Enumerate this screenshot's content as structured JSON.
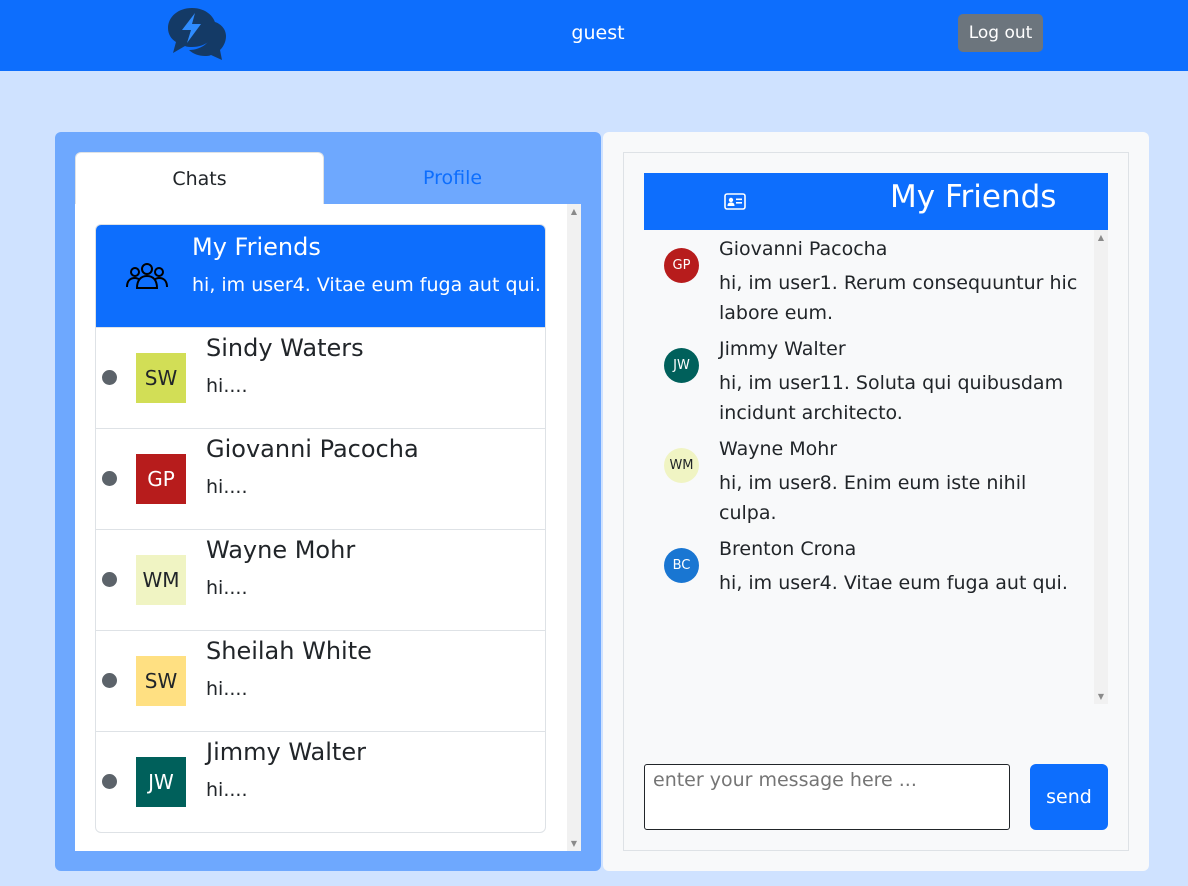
{
  "nav": {
    "username": "guest",
    "logout_label": "Log out",
    "logo_icon": "chat-bubbles-bolt-icon"
  },
  "tabs": [
    {
      "label": "Chats",
      "active": true
    },
    {
      "label": "Profile",
      "active": false
    }
  ],
  "chat_list": {
    "group": {
      "title": "My Friends",
      "last_message": "hi, im user4. Vitae eum fuga aut qui.",
      "icon": "people-icon"
    },
    "friends": [
      {
        "initials": "SW",
        "name": "Sindy Waters",
        "last_message": "hi....",
        "color": "#d2de56",
        "text_color": "#212529"
      },
      {
        "initials": "GP",
        "name": "Giovanni Pacocha",
        "last_message": "hi....",
        "color": "#b71c1c",
        "text_color": "#ffffff"
      },
      {
        "initials": "WM",
        "name": "Wayne Mohr",
        "last_message": "hi....",
        "color": "#f0f4c3",
        "text_color": "#212529"
      },
      {
        "initials": "SW",
        "name": "Sheilah White",
        "last_message": "hi....",
        "color": "#ffe082",
        "text_color": "#212529"
      },
      {
        "initials": "JW",
        "name": "Jimmy Walter",
        "last_message": "hi....",
        "color": "#00605b",
        "text_color": "#ffffff"
      }
    ]
  },
  "chat": {
    "title": "My Friends",
    "header_icon": "contact-card-icon",
    "messages": [
      {
        "initials": "GP",
        "name": "Giovanni Pacocha",
        "text": "hi, im user1. Rerum consequuntur hic labore eum.",
        "color": "#b71c1c",
        "text_color": "#ffffff"
      },
      {
        "initials": "JW",
        "name": "Jimmy Walter",
        "text": "hi, im user11. Soluta qui quibusdam incidunt architecto.",
        "color": "#00605b",
        "text_color": "#ffffff"
      },
      {
        "initials": "WM",
        "name": "Wayne Mohr",
        "text": "hi, im user8. Enim eum iste nihil culpa.",
        "color": "#f0f4c3",
        "text_color": "#212529"
      },
      {
        "initials": "BC",
        "name": "Brenton Crona",
        "text": "hi, im user4. Vitae eum fuga aut qui.",
        "color": "#1976d2",
        "text_color": "#ffffff"
      }
    ],
    "input_placeholder": "enter your message here ...",
    "send_label": "send"
  },
  "colors": {
    "primary": "#0d6efd",
    "page_bg": "#cfe2ff",
    "panel_bg": "#6ea8fe",
    "logout_bg": "#6c757d",
    "status_dot": "#5c636a"
  }
}
